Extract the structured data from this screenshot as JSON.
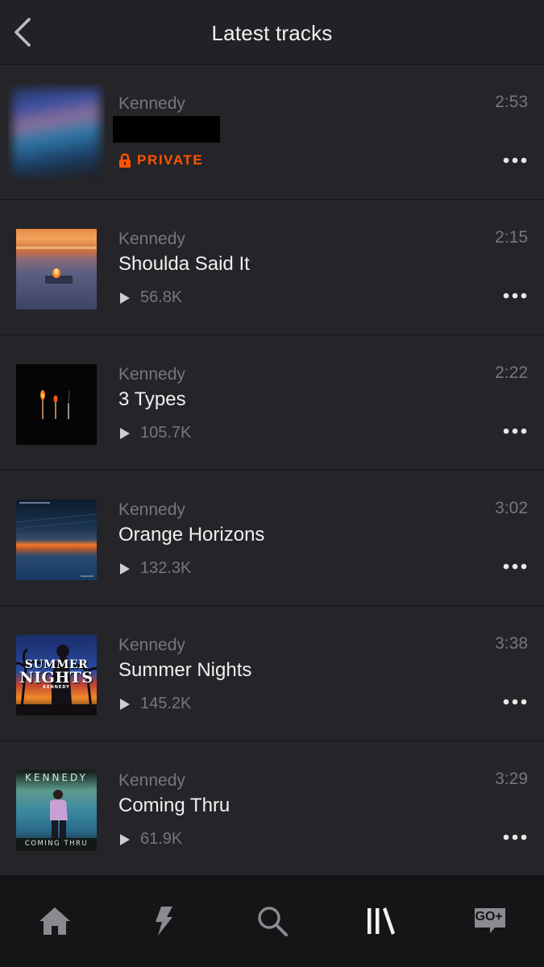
{
  "header": {
    "title": "Latest tracks",
    "back_icon": "chevron-left-icon"
  },
  "tracks": [
    {
      "artist": "Kennedy",
      "title": "",
      "duration": "2:53",
      "private_label": "PRIVATE",
      "plays": null
    },
    {
      "artist": "Kennedy",
      "title": "Shoulda Said It",
      "duration": "2:15",
      "plays": "56.8K"
    },
    {
      "artist": "Kennedy",
      "title": "3 Types",
      "duration": "2:22",
      "plays": "105.7K"
    },
    {
      "artist": "Kennedy",
      "title": "Orange Horizons",
      "duration": "3:02",
      "plays": "132.3K"
    },
    {
      "artist": "Kennedy",
      "title": "Summer Nights",
      "duration": "3:38",
      "plays": "145.2K",
      "art_text": [
        "SUMMER",
        "NIGHTS",
        "KENNEDY"
      ]
    },
    {
      "artist": "Kennedy",
      "title": "Coming Thru",
      "duration": "3:29",
      "plays": "61.9K",
      "art_text": [
        "KENNEDY",
        "COMING THRU"
      ]
    }
  ],
  "tabbar": {
    "items": [
      {
        "icon": "home-icon",
        "active": false
      },
      {
        "icon": "lightning-icon",
        "active": false
      },
      {
        "icon": "search-icon",
        "active": false
      },
      {
        "icon": "library-icon",
        "active": true
      },
      {
        "icon": "go-plus-icon",
        "label": "GO+",
        "active": false
      }
    ]
  },
  "colors": {
    "background": "#252428",
    "accent": "#ff5500",
    "secondary_text": "#77767b",
    "tabbar": "#151417"
  }
}
